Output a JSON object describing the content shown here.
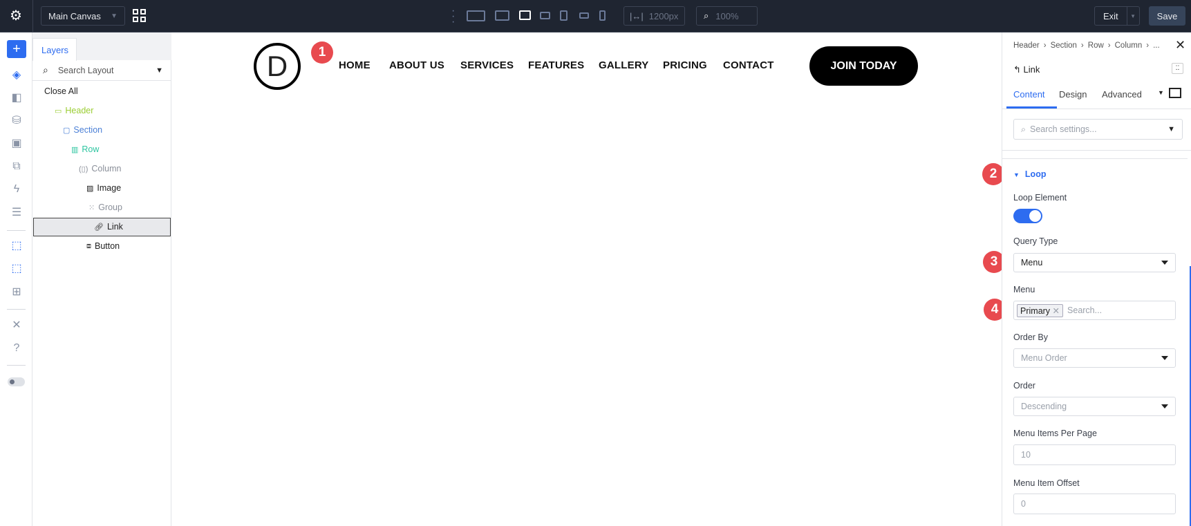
{
  "topbar": {
    "canvas_select": "Main Canvas",
    "width_value": "1200px",
    "zoom_value": "100%",
    "exit_label": "Exit",
    "save_label": "Save"
  },
  "rail": {
    "icons": [
      "add-icon",
      "layers-icon",
      "design-library-icon",
      "database-icon",
      "portability-icon",
      "pages-icon",
      "lightning-icon",
      "theme-builder-icon",
      "select-element-icon",
      "select-multiple-icon",
      "layout-preview-icon",
      "tools-icon",
      "help-icon",
      "toggle-icon"
    ]
  },
  "layers": {
    "tab": "Layers",
    "search_placeholder": "Search Layout",
    "close_all": "Close All",
    "items": [
      {
        "label": "Header",
        "color": "#9acd32"
      },
      {
        "label": "Section",
        "color": "#4a7fd6"
      },
      {
        "label": "Row",
        "color": "#2cc5a0"
      },
      {
        "label": "Column",
        "color": "#8a8f99"
      },
      {
        "label": "Image",
        "color": "#222222"
      },
      {
        "label": "Group",
        "color": "#8a8f99"
      },
      {
        "label": "Link",
        "color": "#222222"
      },
      {
        "label": "Button",
        "color": "#222222"
      }
    ]
  },
  "canvas": {
    "logo_letter": "D",
    "nav": [
      "HOME",
      "ABOUT US",
      "SERVICES",
      "FEATURES",
      "GALLERY",
      "PRICING",
      "CONTACT"
    ],
    "cta": "JOIN TODAY"
  },
  "badges": [
    "1",
    "2",
    "3",
    "4"
  ],
  "panel": {
    "breadcrumb": [
      "Header",
      "Section",
      "Row",
      "Column",
      "..."
    ],
    "element": "Link",
    "tabs": [
      "Content",
      "Design",
      "Advanced"
    ],
    "search_placeholder": "Search settings...",
    "section_title": "Loop",
    "loop_element_label": "Loop Element",
    "loop_element_on": true,
    "query_type_label": "Query Type",
    "query_type": "Menu",
    "menu_label": "Menu",
    "menu_tag": "Primary",
    "menu_search_placeholder": "Search...",
    "order_by_label": "Order By",
    "order_by": "Menu Order",
    "order_label": "Order",
    "order": "Descending",
    "per_page_label": "Menu Items Per Page",
    "per_page": "10",
    "offset_label": "Menu Item Offset",
    "offset": "0"
  },
  "colors": {
    "accent": "#2d6cf0",
    "badge": "#e84a4f",
    "topbar": "#1f2531"
  }
}
